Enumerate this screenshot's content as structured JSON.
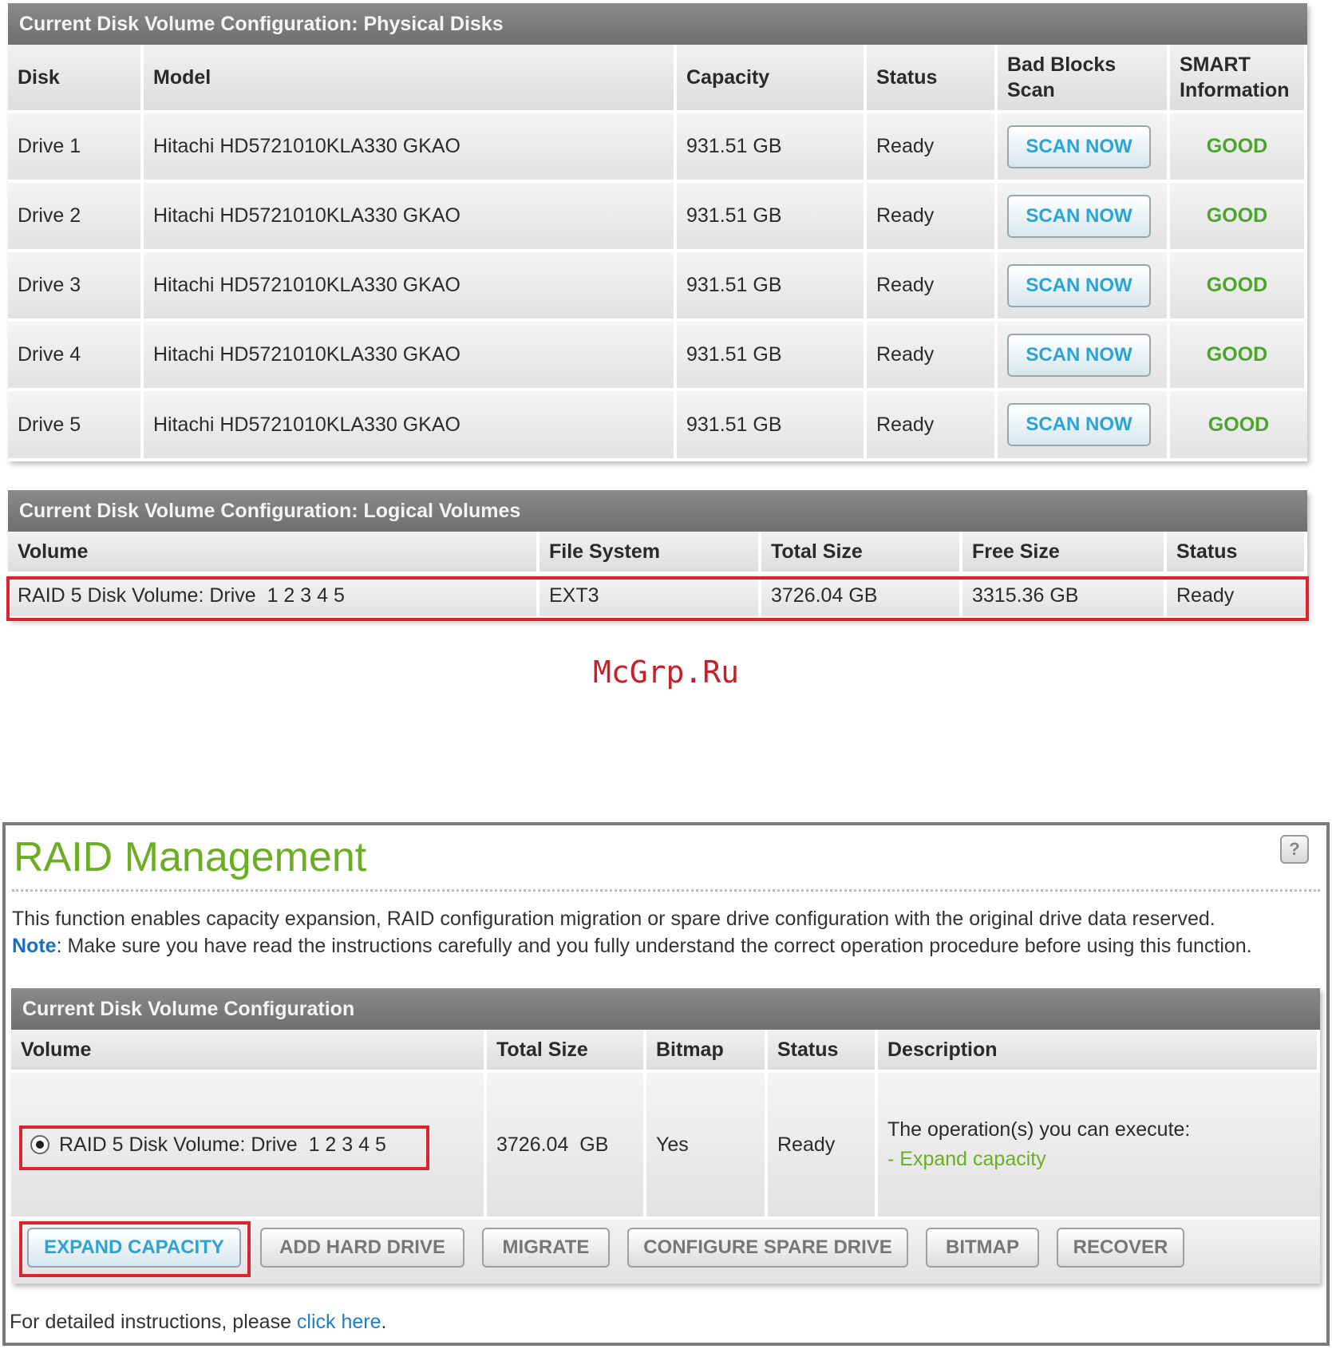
{
  "physical": {
    "title": "Current Disk Volume Configuration: Physical Disks",
    "headers": {
      "disk": "Disk",
      "model": "Model",
      "capacity": "Capacity",
      "status": "Status",
      "scan": "Bad Blocks Scan",
      "smart": "SMART Information"
    },
    "rows": [
      {
        "disk": "Drive 1",
        "model": "Hitachi HD5721010KLA330 GKAO",
        "capacity": "931.51 GB",
        "status": "Ready",
        "scan": "SCAN NOW",
        "smart": "GOOD"
      },
      {
        "disk": "Drive 2",
        "model": "Hitachi HD5721010KLA330 GKAO",
        "capacity": "931.51 GB",
        "status": "Ready",
        "scan": "SCAN NOW",
        "smart": "GOOD"
      },
      {
        "disk": "Drive 3",
        "model": "Hitachi HD5721010KLA330 GKAO",
        "capacity": "931.51 GB",
        "status": "Ready",
        "scan": "SCAN NOW",
        "smart": "GOOD"
      },
      {
        "disk": "Drive 4",
        "model": "Hitachi HD5721010KLA330 GKAO",
        "capacity": "931.51 GB",
        "status": "Ready",
        "scan": "SCAN NOW",
        "smart": "GOOD"
      },
      {
        "disk": "Drive 5",
        "model": "Hitachi HD5721010KLA330 GKAO",
        "capacity": "931.51 GB",
        "status": "Ready",
        "scan": "SCAN NOW",
        "smart": "GOOD"
      }
    ]
  },
  "logical": {
    "title": "Current Disk Volume Configuration: Logical Volumes",
    "headers": {
      "volume": "Volume",
      "fs": "File System",
      "total": "Total Size",
      "free": "Free Size",
      "status": "Status"
    },
    "row": {
      "volume": "RAID 5 Disk Volume: Drive  1 2 3 4 5",
      "fs": "EXT3",
      "total": "3726.04 GB",
      "free": "3315.36 GB",
      "status": "Ready"
    }
  },
  "watermark": "McGrp.Ru",
  "raid": {
    "title": "RAID Management",
    "help": "?",
    "description": "This function enables capacity expansion, RAID configuration migration or spare drive configuration with the original drive data reserved.",
    "note_label": "Note",
    "note_text": ": Make sure you have read the instructions carefully and you fully understand the correct operation procedure before using this function.",
    "config_title": "Current Disk Volume Configuration",
    "headers": {
      "volume": "Volume",
      "total": "Total Size",
      "bitmap": "Bitmap",
      "status": "Status",
      "description": "Description"
    },
    "row": {
      "volume": "RAID 5 Disk Volume: Drive  1 2 3 4 5",
      "total": "3726.04  GB",
      "bitmap": "Yes",
      "status": "Ready",
      "desc_line1": "The operation(s) you can execute:",
      "desc_line2": "- Expand capacity"
    },
    "buttons": {
      "expand": "EXPAND CAPACITY",
      "add": "ADD HARD DRIVE",
      "migrate": "MIGRATE",
      "spare": "CONFIGURE SPARE DRIVE",
      "bitmap": "BITMAP",
      "recover": "RECOVER"
    },
    "footer_text": "For detailed instructions, please ",
    "footer_link": "click here",
    "footer_end": "."
  },
  "colors": {
    "accent_green": "#6cae23",
    "good_green": "#4aa52a",
    "scan_blue": "#2aa3d6",
    "highlight_red": "#d9252b",
    "header_gray": "#7a7a7a"
  }
}
